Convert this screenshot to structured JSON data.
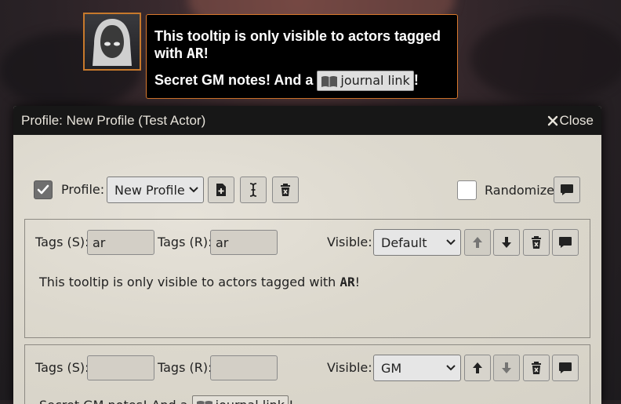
{
  "tooltip": {
    "line1_prefix": "This tooltip is only visible to actors tagged",
    "line1_suffix_pre": "with ",
    "tag": "AR",
    "line1_end": "!",
    "line2_prefix": "Secret GM notes! And a ",
    "link_label": "journal link",
    "line2_end": "!"
  },
  "window": {
    "title": "Profile: New Profile (Test Actor)",
    "close_label": "Close"
  },
  "profile_row": {
    "enabled_checked": true,
    "profile_label": "Profile:",
    "profile_value": "New Profile",
    "randomize_label": "Randomize",
    "randomize_checked": false
  },
  "entries": [
    {
      "tags_s_label": "Tags (S):",
      "tags_s_value": "ar",
      "tags_r_label": "Tags (R):",
      "tags_r_value": "ar",
      "visible_label": "Visible:",
      "visible_value": "Default",
      "text_prefix": "This tooltip is only visible to actors tagged with ",
      "text_tag": "AR",
      "text_end": "!"
    },
    {
      "tags_s_label": "Tags (S):",
      "tags_s_value": "",
      "tags_r_label": "Tags (R):",
      "tags_r_value": "",
      "visible_label": "Visible:",
      "visible_value": "GM",
      "text_prefix": "Secret GM notes! And a ",
      "link_label": "journal link",
      "text_end": "!"
    }
  ],
  "icons": [
    "hooded-figure-icon",
    "book-icon",
    "close-icon",
    "check-icon",
    "add-file-icon",
    "text-cursor-icon",
    "trash-icon",
    "comment-icon",
    "arrow-up-icon",
    "arrow-down-icon",
    "chevron-down-icon"
  ],
  "colors": {
    "tooltip_border": "#d9792d",
    "header_bg": "#171717",
    "panel_bg": "#e9e5dc"
  }
}
